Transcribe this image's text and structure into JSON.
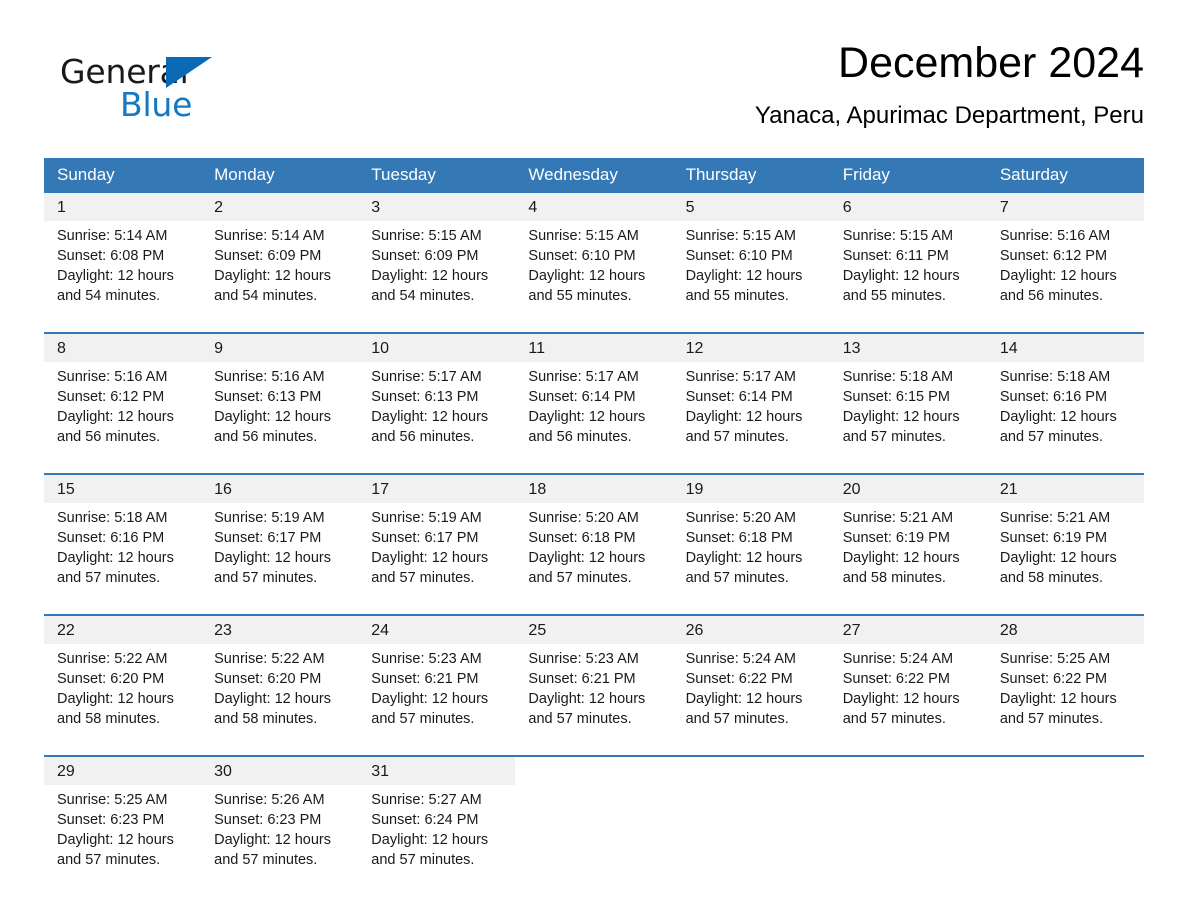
{
  "brand": {
    "name_part1": "General",
    "name_part2": "Blue",
    "triangle_color": "#0a6ab5",
    "blue_text_color": "#1478c4"
  },
  "header": {
    "month_title": "December 2024",
    "location": "Yanaca, Apurimac Department, Peru"
  },
  "theme": {
    "header_row_bg": "#3479b6",
    "header_row_text": "#ffffff",
    "daynum_bg": "#f1f1f1",
    "separator_color": "#3479b6"
  },
  "weekday_headers": [
    "Sunday",
    "Monday",
    "Tuesday",
    "Wednesday",
    "Thursday",
    "Friday",
    "Saturday"
  ],
  "labels": {
    "sunrise_prefix": "Sunrise:",
    "sunset_prefix": "Sunset:",
    "daylight_prefix": "Daylight:"
  },
  "weeks": [
    {
      "days": [
        {
          "date": "1",
          "sunrise": "Sunrise: 5:14 AM",
          "sunset": "Sunset: 6:08 PM",
          "daylight_line1": "Daylight: 12 hours",
          "daylight_line2": "and 54 minutes."
        },
        {
          "date": "2",
          "sunrise": "Sunrise: 5:14 AM",
          "sunset": "Sunset: 6:09 PM",
          "daylight_line1": "Daylight: 12 hours",
          "daylight_line2": "and 54 minutes."
        },
        {
          "date": "3",
          "sunrise": "Sunrise: 5:15 AM",
          "sunset": "Sunset: 6:09 PM",
          "daylight_line1": "Daylight: 12 hours",
          "daylight_line2": "and 54 minutes."
        },
        {
          "date": "4",
          "sunrise": "Sunrise: 5:15 AM",
          "sunset": "Sunset: 6:10 PM",
          "daylight_line1": "Daylight: 12 hours",
          "daylight_line2": "and 55 minutes."
        },
        {
          "date": "5",
          "sunrise": "Sunrise: 5:15 AM",
          "sunset": "Sunset: 6:10 PM",
          "daylight_line1": "Daylight: 12 hours",
          "daylight_line2": "and 55 minutes."
        },
        {
          "date": "6",
          "sunrise": "Sunrise: 5:15 AM",
          "sunset": "Sunset: 6:11 PM",
          "daylight_line1": "Daylight: 12 hours",
          "daylight_line2": "and 55 minutes."
        },
        {
          "date": "7",
          "sunrise": "Sunrise: 5:16 AM",
          "sunset": "Sunset: 6:12 PM",
          "daylight_line1": "Daylight: 12 hours",
          "daylight_line2": "and 56 minutes."
        }
      ]
    },
    {
      "days": [
        {
          "date": "8",
          "sunrise": "Sunrise: 5:16 AM",
          "sunset": "Sunset: 6:12 PM",
          "daylight_line1": "Daylight: 12 hours",
          "daylight_line2": "and 56 minutes."
        },
        {
          "date": "9",
          "sunrise": "Sunrise: 5:16 AM",
          "sunset": "Sunset: 6:13 PM",
          "daylight_line1": "Daylight: 12 hours",
          "daylight_line2": "and 56 minutes."
        },
        {
          "date": "10",
          "sunrise": "Sunrise: 5:17 AM",
          "sunset": "Sunset: 6:13 PM",
          "daylight_line1": "Daylight: 12 hours",
          "daylight_line2": "and 56 minutes."
        },
        {
          "date": "11",
          "sunrise": "Sunrise: 5:17 AM",
          "sunset": "Sunset: 6:14 PM",
          "daylight_line1": "Daylight: 12 hours",
          "daylight_line2": "and 56 minutes."
        },
        {
          "date": "12",
          "sunrise": "Sunrise: 5:17 AM",
          "sunset": "Sunset: 6:14 PM",
          "daylight_line1": "Daylight: 12 hours",
          "daylight_line2": "and 57 minutes."
        },
        {
          "date": "13",
          "sunrise": "Sunrise: 5:18 AM",
          "sunset": "Sunset: 6:15 PM",
          "daylight_line1": "Daylight: 12 hours",
          "daylight_line2": "and 57 minutes."
        },
        {
          "date": "14",
          "sunrise": "Sunrise: 5:18 AM",
          "sunset": "Sunset: 6:16 PM",
          "daylight_line1": "Daylight: 12 hours",
          "daylight_line2": "and 57 minutes."
        }
      ]
    },
    {
      "days": [
        {
          "date": "15",
          "sunrise": "Sunrise: 5:18 AM",
          "sunset": "Sunset: 6:16 PM",
          "daylight_line1": "Daylight: 12 hours",
          "daylight_line2": "and 57 minutes."
        },
        {
          "date": "16",
          "sunrise": "Sunrise: 5:19 AM",
          "sunset": "Sunset: 6:17 PM",
          "daylight_line1": "Daylight: 12 hours",
          "daylight_line2": "and 57 minutes."
        },
        {
          "date": "17",
          "sunrise": "Sunrise: 5:19 AM",
          "sunset": "Sunset: 6:17 PM",
          "daylight_line1": "Daylight: 12 hours",
          "daylight_line2": "and 57 minutes."
        },
        {
          "date": "18",
          "sunrise": "Sunrise: 5:20 AM",
          "sunset": "Sunset: 6:18 PM",
          "daylight_line1": "Daylight: 12 hours",
          "daylight_line2": "and 57 minutes."
        },
        {
          "date": "19",
          "sunrise": "Sunrise: 5:20 AM",
          "sunset": "Sunset: 6:18 PM",
          "daylight_line1": "Daylight: 12 hours",
          "daylight_line2": "and 57 minutes."
        },
        {
          "date": "20",
          "sunrise": "Sunrise: 5:21 AM",
          "sunset": "Sunset: 6:19 PM",
          "daylight_line1": "Daylight: 12 hours",
          "daylight_line2": "and 58 minutes."
        },
        {
          "date": "21",
          "sunrise": "Sunrise: 5:21 AM",
          "sunset": "Sunset: 6:19 PM",
          "daylight_line1": "Daylight: 12 hours",
          "daylight_line2": "and 58 minutes."
        }
      ]
    },
    {
      "days": [
        {
          "date": "22",
          "sunrise": "Sunrise: 5:22 AM",
          "sunset": "Sunset: 6:20 PM",
          "daylight_line1": "Daylight: 12 hours",
          "daylight_line2": "and 58 minutes."
        },
        {
          "date": "23",
          "sunrise": "Sunrise: 5:22 AM",
          "sunset": "Sunset: 6:20 PM",
          "daylight_line1": "Daylight: 12 hours",
          "daylight_line2": "and 58 minutes."
        },
        {
          "date": "24",
          "sunrise": "Sunrise: 5:23 AM",
          "sunset": "Sunset: 6:21 PM",
          "daylight_line1": "Daylight: 12 hours",
          "daylight_line2": "and 57 minutes."
        },
        {
          "date": "25",
          "sunrise": "Sunrise: 5:23 AM",
          "sunset": "Sunset: 6:21 PM",
          "daylight_line1": "Daylight: 12 hours",
          "daylight_line2": "and 57 minutes."
        },
        {
          "date": "26",
          "sunrise": "Sunrise: 5:24 AM",
          "sunset": "Sunset: 6:22 PM",
          "daylight_line1": "Daylight: 12 hours",
          "daylight_line2": "and 57 minutes."
        },
        {
          "date": "27",
          "sunrise": "Sunrise: 5:24 AM",
          "sunset": "Sunset: 6:22 PM",
          "daylight_line1": "Daylight: 12 hours",
          "daylight_line2": "and 57 minutes."
        },
        {
          "date": "28",
          "sunrise": "Sunrise: 5:25 AM",
          "sunset": "Sunset: 6:22 PM",
          "daylight_line1": "Daylight: 12 hours",
          "daylight_line2": "and 57 minutes."
        }
      ]
    },
    {
      "days": [
        {
          "date": "29",
          "sunrise": "Sunrise: 5:25 AM",
          "sunset": "Sunset: 6:23 PM",
          "daylight_line1": "Daylight: 12 hours",
          "daylight_line2": "and 57 minutes."
        },
        {
          "date": "30",
          "sunrise": "Sunrise: 5:26 AM",
          "sunset": "Sunset: 6:23 PM",
          "daylight_line1": "Daylight: 12 hours",
          "daylight_line2": "and 57 minutes."
        },
        {
          "date": "31",
          "sunrise": "Sunrise: 5:27 AM",
          "sunset": "Sunset: 6:24 PM",
          "daylight_line1": "Daylight: 12 hours",
          "daylight_line2": "and 57 minutes."
        },
        {
          "date": "",
          "sunrise": "",
          "sunset": "",
          "daylight_line1": "",
          "daylight_line2": ""
        },
        {
          "date": "",
          "sunrise": "",
          "sunset": "",
          "daylight_line1": "",
          "daylight_line2": ""
        },
        {
          "date": "",
          "sunrise": "",
          "sunset": "",
          "daylight_line1": "",
          "daylight_line2": ""
        },
        {
          "date": "",
          "sunrise": "",
          "sunset": "",
          "daylight_line1": "",
          "daylight_line2": ""
        }
      ]
    }
  ]
}
